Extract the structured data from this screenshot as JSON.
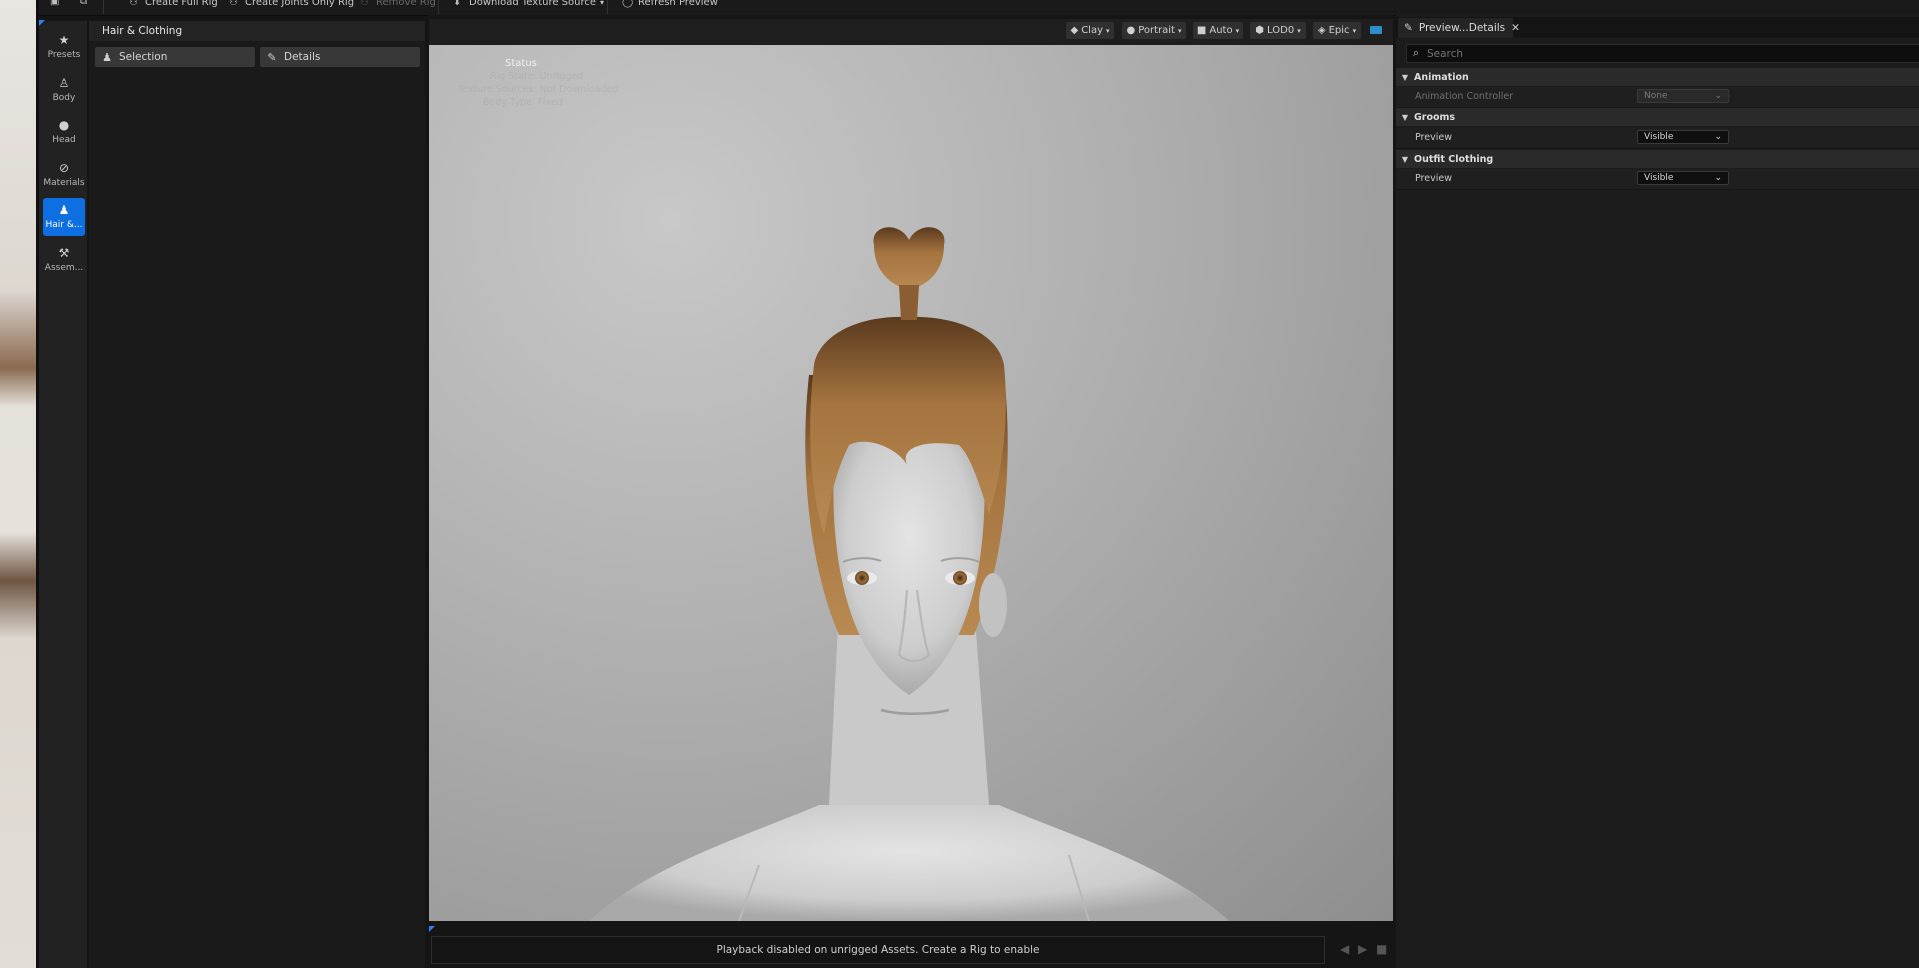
{
  "toolbar": {
    "items": [
      {
        "label": "Create Full Rig",
        "icon": "rig-icon",
        "enabled": true
      },
      {
        "label": "Create Joints Only Rig",
        "icon": "joints-rig-icon",
        "enabled": true
      },
      {
        "label": "Remove Rig",
        "icon": "remove-rig-icon",
        "enabled": false
      },
      {
        "label": "Download Texture Source",
        "icon": "download-icon",
        "enabled": true
      },
      {
        "label": "Refresh Preview",
        "icon": "refresh-icon",
        "enabled": true
      }
    ]
  },
  "sidenav": {
    "items": [
      {
        "label": "Presets",
        "icon": "star-icon",
        "glyph": "★"
      },
      {
        "label": "Body",
        "icon": "body-icon",
        "glyph": "♙"
      },
      {
        "label": "Head",
        "icon": "head-icon",
        "glyph": "●"
      },
      {
        "label": "Materials",
        "icon": "materials-icon",
        "glyph": "⊘"
      },
      {
        "label": "Hair &...",
        "icon": "hair-clothing-icon",
        "glyph": "♟",
        "active": true
      },
      {
        "label": "Assem...",
        "icon": "assembly-icon",
        "glyph": "⚒"
      }
    ]
  },
  "left_panel": {
    "title": "Hair & Clothing",
    "tabs": [
      {
        "label": "Selection",
        "icon": "selection-icon"
      },
      {
        "label": "Details",
        "icon": "pencil-icon"
      }
    ]
  },
  "viewport": {
    "toolbar": [
      {
        "label": "Clay",
        "icon": "clay-icon"
      },
      {
        "label": "Portrait",
        "icon": "lighting-icon"
      },
      {
        "label": "Auto",
        "icon": "camera-icon"
      },
      {
        "label": "LOD0",
        "icon": "lod-icon"
      },
      {
        "label": "Epic",
        "icon": "quality-icon"
      }
    ],
    "status_title": "Status",
    "status_lines": [
      "Rig State: Unrigged",
      "Texture Sources: Not Downloaded",
      "Body Type: Fixed"
    ],
    "playback_message": "Playback disabled on unrigged Assets. Create a Rig to enable"
  },
  "details": {
    "tab_label": "Preview...Details",
    "search_placeholder": "Search",
    "categories": [
      {
        "name": "Animation",
        "props": [
          {
            "label": "Animation Controller",
            "value": "None",
            "enabled": false
          }
        ]
      },
      {
        "name": "Grooms",
        "props": [
          {
            "label": "Preview",
            "value": "Visible",
            "enabled": true
          }
        ]
      },
      {
        "name": "Outfit Clothing",
        "props": [
          {
            "label": "Preview",
            "value": "Visible",
            "enabled": true
          }
        ]
      }
    ]
  },
  "colors": {
    "accent": "#0e6fe2",
    "hair": "#9b6a3a",
    "skin": "#d6d6d6"
  }
}
